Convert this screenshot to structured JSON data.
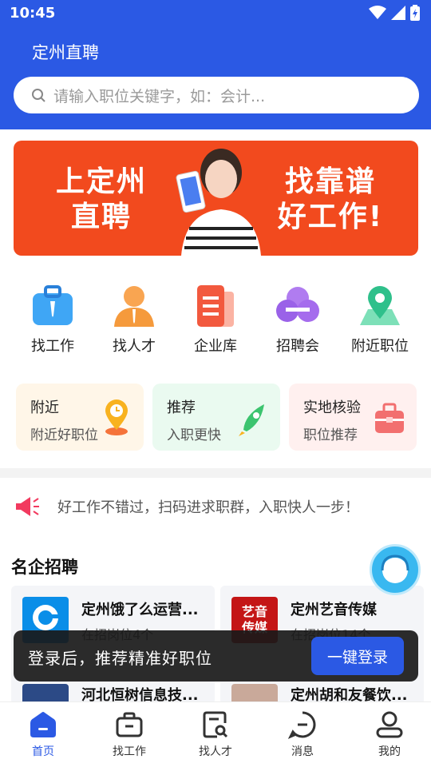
{
  "status_bar": {
    "time": "10:45"
  },
  "header": {
    "title": "定州直聘",
    "search_placeholder": "请输入职位关键字，如：会计..."
  },
  "banner": {
    "left_line1": "上定州",
    "left_line2": "直聘",
    "right_line1": "找靠谱",
    "right_line2": "好工作!"
  },
  "menu": [
    {
      "label": "找工作",
      "icon": "briefcase-icon"
    },
    {
      "label": "找人才",
      "icon": "person-icon"
    },
    {
      "label": "企业库",
      "icon": "building-icon"
    },
    {
      "label": "招聘会",
      "icon": "cloud-icon"
    },
    {
      "label": "附近职位",
      "icon": "location-icon"
    }
  ],
  "cards": [
    {
      "title": "附近",
      "subtitle": "附近好职位",
      "icon": "pin-icon",
      "bg": "#fff6e8"
    },
    {
      "title": "推荐",
      "subtitle": "入职更快",
      "icon": "rocket-icon",
      "bg": "#eafaf0"
    },
    {
      "title": "实地核验",
      "subtitle": "职位推荐",
      "icon": "suitcase-icon",
      "bg": "#fff0ef"
    }
  ],
  "notice": {
    "text": "好工作不错过，扫码进求职群，入职快人一步！"
  },
  "section": {
    "title": "名企招聘"
  },
  "companies": [
    {
      "name": "定州饿了么运营...",
      "count": "在招岗位4个",
      "logo_text": "饿了么"
    },
    {
      "name": "定州艺音传媒",
      "count": "在招岗位14个",
      "logo_text": "艺音传媒"
    },
    {
      "name": "河北恒树信息技...",
      "count": ""
    },
    {
      "name": "定州胡和友餐饮...",
      "count": ""
    }
  ],
  "toast": {
    "text": "登录后，推荐精准好职位",
    "button": "一键登录"
  },
  "tabs": [
    {
      "label": "首页",
      "icon": "home-icon",
      "active": true
    },
    {
      "label": "找工作",
      "icon": "briefcase-icon"
    },
    {
      "label": "找人才",
      "icon": "resume-search-icon"
    },
    {
      "label": "消息",
      "icon": "message-icon"
    },
    {
      "label": "我的",
      "icon": "user-icon"
    }
  ],
  "colors": {
    "primary": "#2b59e4",
    "banner": "#f24a1e"
  }
}
